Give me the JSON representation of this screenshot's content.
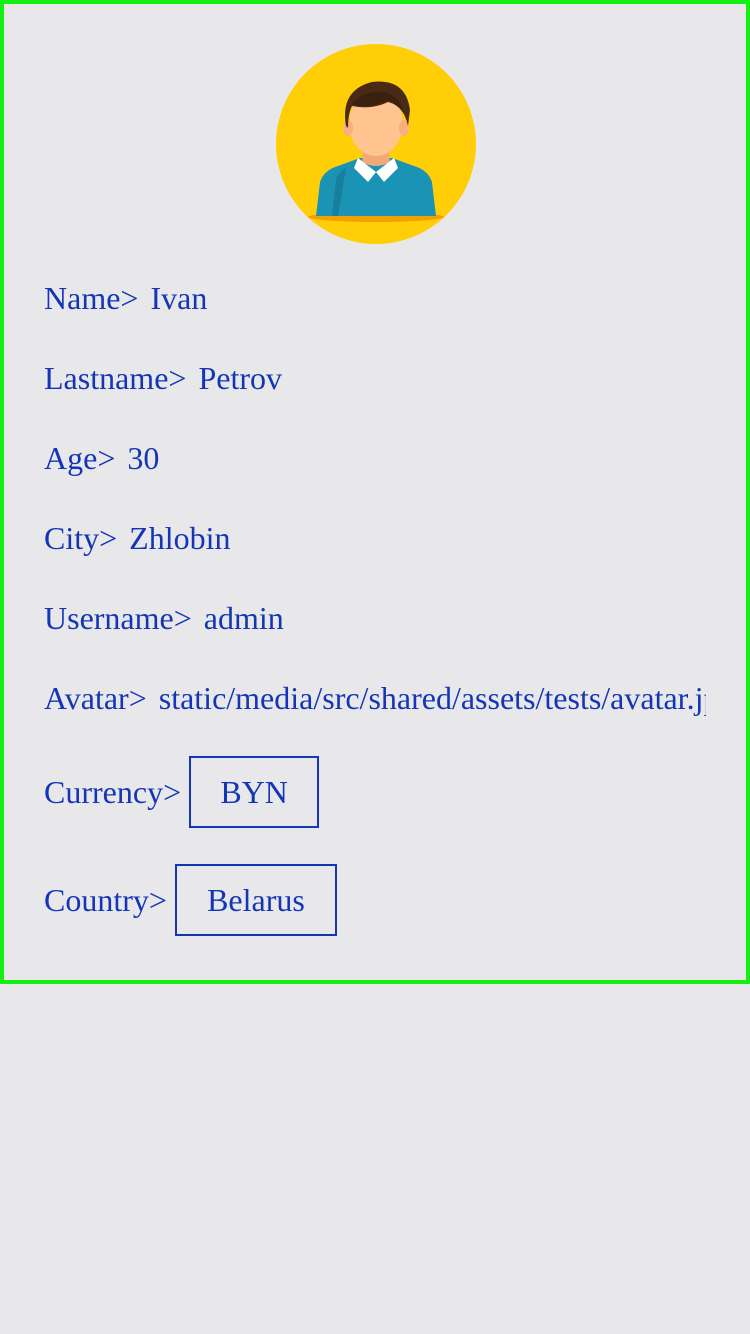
{
  "profile": {
    "avatar_icon": "user-avatar-icon",
    "fields": {
      "name": {
        "label": "Name>",
        "value": "Ivan"
      },
      "lastname": {
        "label": "Lastname>",
        "value": "Petrov"
      },
      "age": {
        "label": "Age>",
        "value": "30"
      },
      "city": {
        "label": "City>",
        "value": "Zhlobin"
      },
      "username": {
        "label": "Username>",
        "value": "admin"
      },
      "avatar": {
        "label": "Avatar>",
        "value": "static/media/src/shared/assets/tests/avatar.jpg"
      },
      "currency": {
        "label": "Currency>",
        "value": "BYN"
      },
      "country": {
        "label": "Country>",
        "value": "Belarus"
      }
    }
  },
  "colors": {
    "text": "#1436b6",
    "border": "#15f014",
    "background": "#e8e8ea",
    "avatar_bg": "#ffce06"
  }
}
